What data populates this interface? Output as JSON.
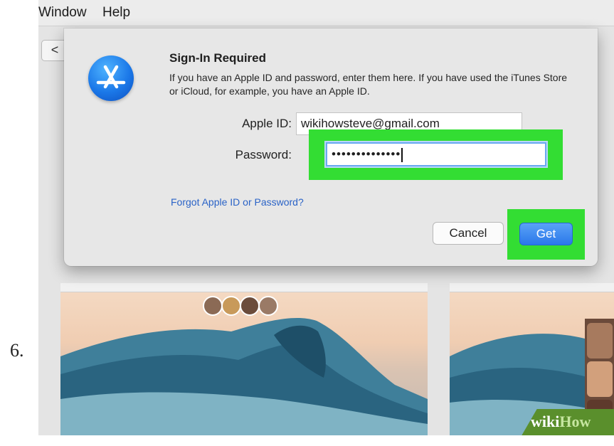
{
  "step": {
    "number": "6."
  },
  "menubar": {
    "items": [
      "Window",
      "Help"
    ]
  },
  "toolbar": {
    "back_glyph": "<"
  },
  "dialog": {
    "title": "Sign-In Required",
    "message": "If you have an Apple ID and password, enter them here. If you have used the iTunes Store or iCloud, for example, you have an Apple ID.",
    "apple_id_label": "Apple ID:",
    "apple_id_value": "wikihowsteve@gmail.com",
    "password_label": "Password:",
    "password_mask": "••••••••••••••",
    "forgot_link": "Forgot Apple ID or Password?",
    "cancel_label": "Cancel",
    "get_label": "Get",
    "icon": "app-store-icon"
  },
  "highlight_color": "#33dd33",
  "accent_color": "#2a78ea",
  "watermark": {
    "part1": "wiki",
    "part2": "How"
  }
}
